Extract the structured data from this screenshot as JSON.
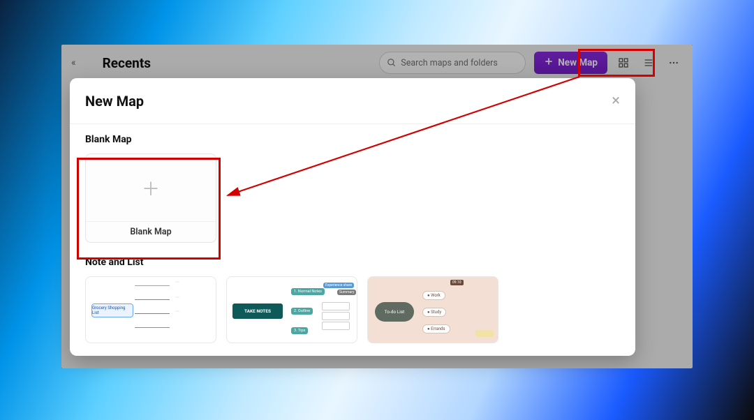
{
  "header": {
    "page_title": "Recents",
    "search_placeholder": "Search maps and folders",
    "new_map_label": "New Map"
  },
  "modal": {
    "title": "New Map",
    "sections": {
      "blank": {
        "title": "Blank Map",
        "card_label": "Blank Map"
      },
      "note_list": {
        "title": "Note and List",
        "templates": [
          {
            "root": "Grocery Shopping List"
          },
          {
            "root": "TAKE NOTES"
          },
          {
            "root": "To-do List"
          }
        ]
      }
    }
  },
  "colors": {
    "accent": "#8a2be2",
    "annotation": "#d40000"
  }
}
